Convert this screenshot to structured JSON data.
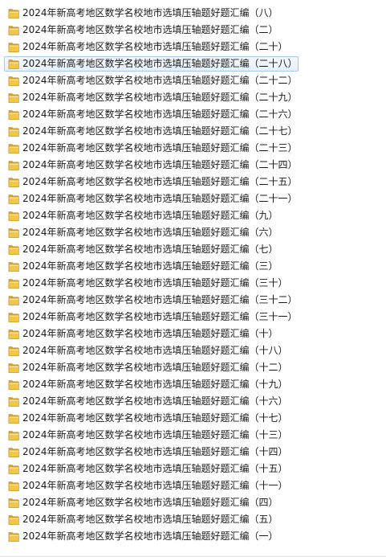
{
  "files": [
    {
      "name": "2024年新高考地区数学名校地市选填压轴题好题汇编（八）"
    },
    {
      "name": "2024年新高考地区数学名校地市选填压轴题好题汇编（二）"
    },
    {
      "name": "2024年新高考地区数学名校地市选填压轴题好题汇编（二十）"
    },
    {
      "name": "2024年新高考地区数学名校地市选填压轴题好题汇编（二十八）",
      "selected": true
    },
    {
      "name": "2024年新高考地区数学名校地市选填压轴题好题汇编（二十二）"
    },
    {
      "name": "2024年新高考地区数学名校地市选填压轴题好题汇编（二十九）"
    },
    {
      "name": "2024年新高考地区数学名校地市选填压轴题好题汇编（二十六）"
    },
    {
      "name": "2024年新高考地区数学名校地市选填压轴题好题汇编（二十七）"
    },
    {
      "name": "2024年新高考地区数学名校地市选填压轴题好题汇编（二十三）"
    },
    {
      "name": "2024年新高考地区数学名校地市选填压轴题好题汇编（二十四）"
    },
    {
      "name": "2024年新高考地区数学名校地市选填压轴题好题汇编（二十五）"
    },
    {
      "name": "2024年新高考地区数学名校地市选填压轴题好题汇编（二十一）"
    },
    {
      "name": "2024年新高考地区数学名校地市选填压轴题好题汇编（九）"
    },
    {
      "name": "2024年新高考地区数学名校地市选填压轴题好题汇编（六）"
    },
    {
      "name": "2024年新高考地区数学名校地市选填压轴题好题汇编（七）"
    },
    {
      "name": "2024年新高考地区数学名校地市选填压轴题好题汇编（三）"
    },
    {
      "name": "2024年新高考地区数学名校地市选填压轴题好题汇编（三十）"
    },
    {
      "name": "2024年新高考地区数学名校地市选填压轴题好题汇编（三十二）"
    },
    {
      "name": "2024年新高考地区数学名校地市选填压轴题好题汇编（三十一）"
    },
    {
      "name": "2024年新高考地区数学名校地市选填压轴题好题汇编（十）"
    },
    {
      "name": "2024年新高考地区数学名校地市选填压轴题好题汇编（十八）"
    },
    {
      "name": "2024年新高考地区数学名校地市选填压轴题好题汇编（十二）"
    },
    {
      "name": "2024年新高考地区数学名校地市选填压轴题好题汇编（十九）"
    },
    {
      "name": "2024年新高考地区数学名校地市选填压轴题好题汇编（十六）"
    },
    {
      "name": "2024年新高考地区数学名校地市选填压轴题好题汇编（十七）"
    },
    {
      "name": "2024年新高考地区数学名校地市选填压轴题好题汇编（十三）"
    },
    {
      "name": "2024年新高考地区数学名校地市选填压轴题好题汇编（十四）"
    },
    {
      "name": "2024年新高考地区数学名校地市选填压轴题好题汇编（十五）"
    },
    {
      "name": "2024年新高考地区数学名校地市选填压轴题好题汇编（十一）"
    },
    {
      "name": "2024年新高考地区数学名校地市选填压轴题好题汇编（四）"
    },
    {
      "name": "2024年新高考地区数学名校地市选填压轴题好题汇编（五）"
    },
    {
      "name": "2024年新高考地区数学名校地市选填压轴题好题汇编（一）"
    }
  ],
  "icon": "folder-icon",
  "colors": {
    "folder_body": "#e8b93a",
    "folder_front": "#f7d46a",
    "selection_border": "#a8c9ea",
    "text": "#1a1a1a"
  }
}
